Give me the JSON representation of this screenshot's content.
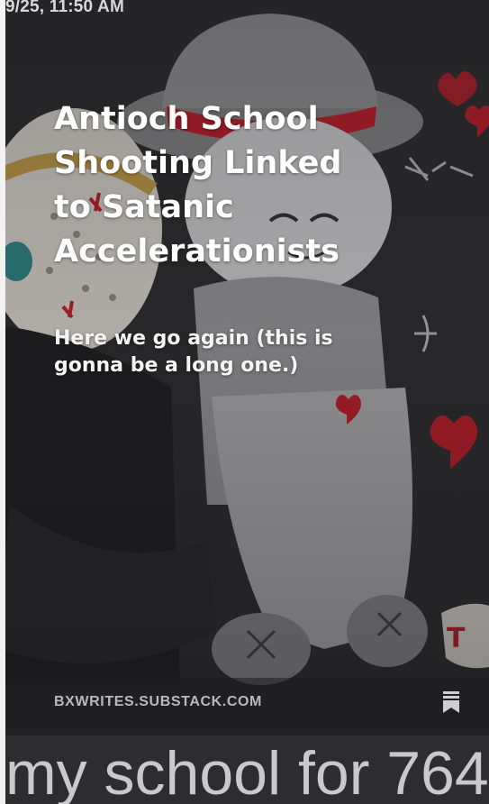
{
  "status": {
    "timestamp": "9/25, 11:50 AM"
  },
  "card": {
    "title": "Antioch School Shooting Linked to Satanic Accelerationists",
    "subtitle": "Here we go again (this is gonna be a long one.)",
    "publication": "BXWRITES.SUBSTACK.COM",
    "bookmark_icon": "bookmark-icon"
  },
  "background_text": "my school for 764",
  "colors": {
    "background": "#2b2b2d",
    "title_text": "#ffffff",
    "publication_text": "#b9b9bb",
    "accent_red": "#c81e2a"
  }
}
